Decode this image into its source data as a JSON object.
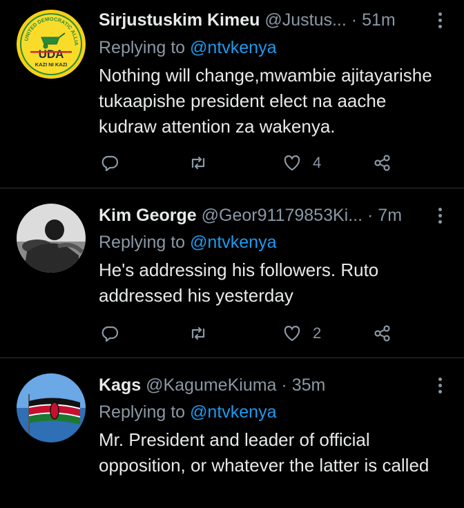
{
  "tweets": [
    {
      "avatar": {
        "text_top": "UNITED DEMOCRATIC ALLIANCE",
        "label": "UDA",
        "subtitle": "KAZI NI KAZI"
      },
      "name": "Sirjustuskim Kimeu",
      "handle": "@Justus...",
      "dot": "·",
      "time": "51m",
      "replying_prefix": "Replying to ",
      "replying_to": "@ntvkenya",
      "text": "Nothing will change,mwambie ajitayarishe tukaapishe president elect na aache kudraw attention za wakenya.",
      "likes": "4"
    },
    {
      "name": "Kim George",
      "handle": "@Geor91179853Ki...",
      "dot": "·",
      "time": "7m",
      "replying_prefix": "Replying to ",
      "replying_to": "@ntvkenya",
      "text": "He's addressing his followers. Ruto addressed his yesterday",
      "likes": "2"
    },
    {
      "name": "Kags",
      "handle": "@KagumeKiuma",
      "dot": "·",
      "time": "35m",
      "replying_prefix": "Replying to ",
      "replying_to": "@ntvkenya",
      "text": "Mr. President and leader of official opposition, or whatever the latter is called"
    }
  ],
  "icons": [
    "reply-icon",
    "retweet-icon",
    "like-icon",
    "share-icon",
    "more-icon"
  ],
  "colors": {
    "background": "#000000",
    "text": "#e7e9ea",
    "muted": "#8b98a5",
    "link": "#1d9bf0",
    "divider": "#2f3336"
  }
}
